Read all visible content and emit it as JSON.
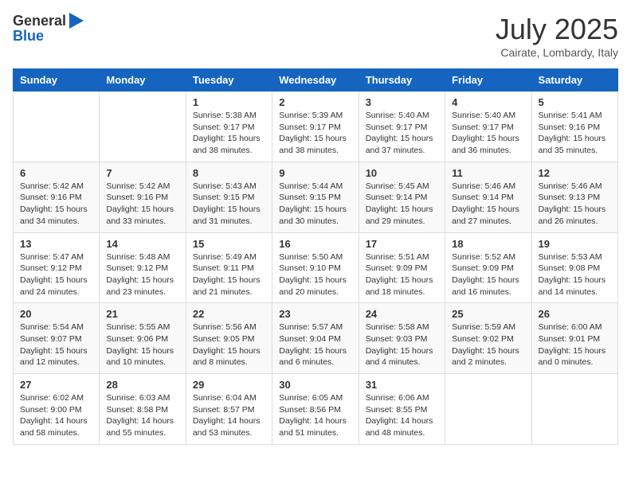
{
  "header": {
    "logo_general": "General",
    "logo_blue": "Blue",
    "month_title": "July 2025",
    "location": "Cairate, Lombardy, Italy"
  },
  "days_of_week": [
    "Sunday",
    "Monday",
    "Tuesday",
    "Wednesday",
    "Thursday",
    "Friday",
    "Saturday"
  ],
  "weeks": [
    [
      {
        "num": "",
        "info": ""
      },
      {
        "num": "",
        "info": ""
      },
      {
        "num": "1",
        "info": "Sunrise: 5:38 AM\nSunset: 9:17 PM\nDaylight: 15 hours\nand 38 minutes."
      },
      {
        "num": "2",
        "info": "Sunrise: 5:39 AM\nSunset: 9:17 PM\nDaylight: 15 hours\nand 38 minutes."
      },
      {
        "num": "3",
        "info": "Sunrise: 5:40 AM\nSunset: 9:17 PM\nDaylight: 15 hours\nand 37 minutes."
      },
      {
        "num": "4",
        "info": "Sunrise: 5:40 AM\nSunset: 9:17 PM\nDaylight: 15 hours\nand 36 minutes."
      },
      {
        "num": "5",
        "info": "Sunrise: 5:41 AM\nSunset: 9:16 PM\nDaylight: 15 hours\nand 35 minutes."
      }
    ],
    [
      {
        "num": "6",
        "info": "Sunrise: 5:42 AM\nSunset: 9:16 PM\nDaylight: 15 hours\nand 34 minutes."
      },
      {
        "num": "7",
        "info": "Sunrise: 5:42 AM\nSunset: 9:16 PM\nDaylight: 15 hours\nand 33 minutes."
      },
      {
        "num": "8",
        "info": "Sunrise: 5:43 AM\nSunset: 9:15 PM\nDaylight: 15 hours\nand 31 minutes."
      },
      {
        "num": "9",
        "info": "Sunrise: 5:44 AM\nSunset: 9:15 PM\nDaylight: 15 hours\nand 30 minutes."
      },
      {
        "num": "10",
        "info": "Sunrise: 5:45 AM\nSunset: 9:14 PM\nDaylight: 15 hours\nand 29 minutes."
      },
      {
        "num": "11",
        "info": "Sunrise: 5:46 AM\nSunset: 9:14 PM\nDaylight: 15 hours\nand 27 minutes."
      },
      {
        "num": "12",
        "info": "Sunrise: 5:46 AM\nSunset: 9:13 PM\nDaylight: 15 hours\nand 26 minutes."
      }
    ],
    [
      {
        "num": "13",
        "info": "Sunrise: 5:47 AM\nSunset: 9:12 PM\nDaylight: 15 hours\nand 24 minutes."
      },
      {
        "num": "14",
        "info": "Sunrise: 5:48 AM\nSunset: 9:12 PM\nDaylight: 15 hours\nand 23 minutes."
      },
      {
        "num": "15",
        "info": "Sunrise: 5:49 AM\nSunset: 9:11 PM\nDaylight: 15 hours\nand 21 minutes."
      },
      {
        "num": "16",
        "info": "Sunrise: 5:50 AM\nSunset: 9:10 PM\nDaylight: 15 hours\nand 20 minutes."
      },
      {
        "num": "17",
        "info": "Sunrise: 5:51 AM\nSunset: 9:09 PM\nDaylight: 15 hours\nand 18 minutes."
      },
      {
        "num": "18",
        "info": "Sunrise: 5:52 AM\nSunset: 9:09 PM\nDaylight: 15 hours\nand 16 minutes."
      },
      {
        "num": "19",
        "info": "Sunrise: 5:53 AM\nSunset: 9:08 PM\nDaylight: 15 hours\nand 14 minutes."
      }
    ],
    [
      {
        "num": "20",
        "info": "Sunrise: 5:54 AM\nSunset: 9:07 PM\nDaylight: 15 hours\nand 12 minutes."
      },
      {
        "num": "21",
        "info": "Sunrise: 5:55 AM\nSunset: 9:06 PM\nDaylight: 15 hours\nand 10 minutes."
      },
      {
        "num": "22",
        "info": "Sunrise: 5:56 AM\nSunset: 9:05 PM\nDaylight: 15 hours\nand 8 minutes."
      },
      {
        "num": "23",
        "info": "Sunrise: 5:57 AM\nSunset: 9:04 PM\nDaylight: 15 hours\nand 6 minutes."
      },
      {
        "num": "24",
        "info": "Sunrise: 5:58 AM\nSunset: 9:03 PM\nDaylight: 15 hours\nand 4 minutes."
      },
      {
        "num": "25",
        "info": "Sunrise: 5:59 AM\nSunset: 9:02 PM\nDaylight: 15 hours\nand 2 minutes."
      },
      {
        "num": "26",
        "info": "Sunrise: 6:00 AM\nSunset: 9:01 PM\nDaylight: 15 hours\nand 0 minutes."
      }
    ],
    [
      {
        "num": "27",
        "info": "Sunrise: 6:02 AM\nSunset: 9:00 PM\nDaylight: 14 hours\nand 58 minutes."
      },
      {
        "num": "28",
        "info": "Sunrise: 6:03 AM\nSunset: 8:58 PM\nDaylight: 14 hours\nand 55 minutes."
      },
      {
        "num": "29",
        "info": "Sunrise: 6:04 AM\nSunset: 8:57 PM\nDaylight: 14 hours\nand 53 minutes."
      },
      {
        "num": "30",
        "info": "Sunrise: 6:05 AM\nSunset: 8:56 PM\nDaylight: 14 hours\nand 51 minutes."
      },
      {
        "num": "31",
        "info": "Sunrise: 6:06 AM\nSunset: 8:55 PM\nDaylight: 14 hours\nand 48 minutes."
      },
      {
        "num": "",
        "info": ""
      },
      {
        "num": "",
        "info": ""
      }
    ]
  ]
}
